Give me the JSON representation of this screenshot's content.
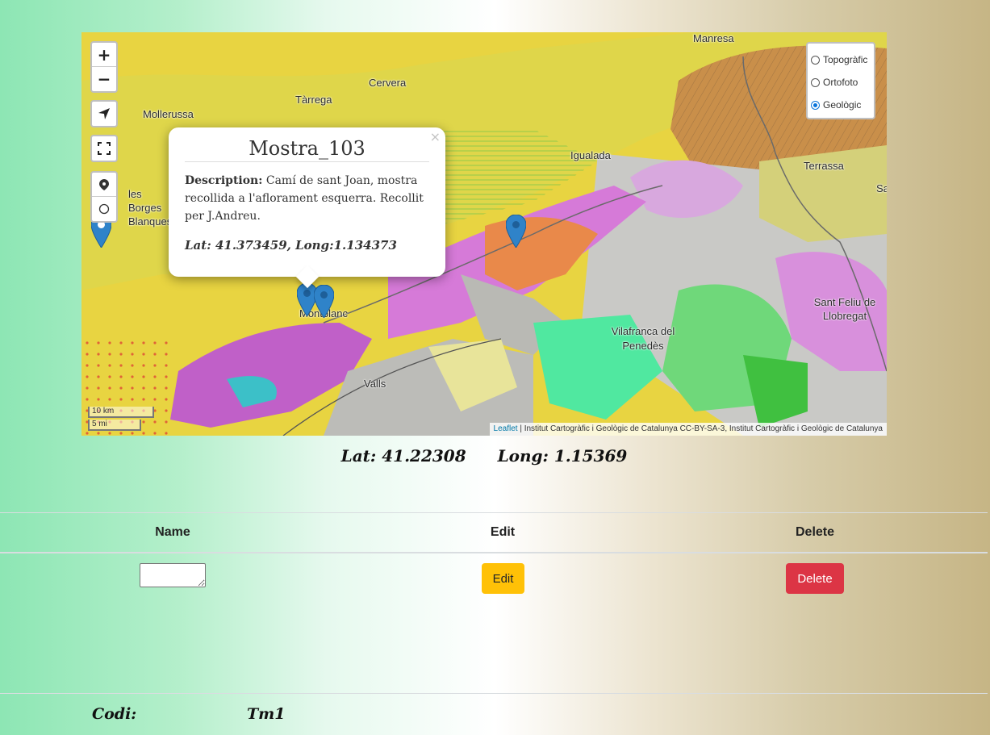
{
  "map": {
    "zoom_in": "+",
    "zoom_out": "−",
    "place_labels": [
      "Manresa",
      "Cervera",
      "Tàrrega",
      "Mollerussa",
      "Igualada",
      "Terrassa",
      "les Borges Blanques",
      "Montblanc",
      "Valls",
      "Vilafranca del Penedès",
      "Sant Feliu de Llobregat",
      "Sa"
    ],
    "layers": [
      {
        "label": "Topogràfic",
        "selected": false
      },
      {
        "label": "Ortofoto",
        "selected": false
      },
      {
        "label": "Geològic",
        "selected": true
      }
    ],
    "scale_km": "10 km",
    "scale_mi": "5 mi",
    "attribution_link": "Leaflet",
    "attribution_text": "| Institut Cartogràfic i Geològic de Catalunya CC-BY-SA-3, Institut Cartogràfic i Geològic de Catalunya",
    "marker_color": "#2f83c9"
  },
  "popup": {
    "close": "×",
    "title": "Mostra_103",
    "description_label": "Description:",
    "description_text": "Camí de sant Joan, mostra recollida a l'aflorament esquerra. Recollit per J.Andreu.",
    "coords": "Lat: 41.373459, Long:1.134373"
  },
  "current_position": {
    "lat": "Lat: 41.22308",
    "long": "Long: 1.15369"
  },
  "table": {
    "headers": [
      "Name",
      "Edit",
      "Delete"
    ],
    "name_value": "",
    "edit_label": "Edit",
    "delete_label": "Delete"
  },
  "footer": {
    "codi_label": "Codi:",
    "codi_value": "Tm1"
  },
  "colors": {
    "edit": "#ffc107",
    "delete": "#dc3545"
  }
}
